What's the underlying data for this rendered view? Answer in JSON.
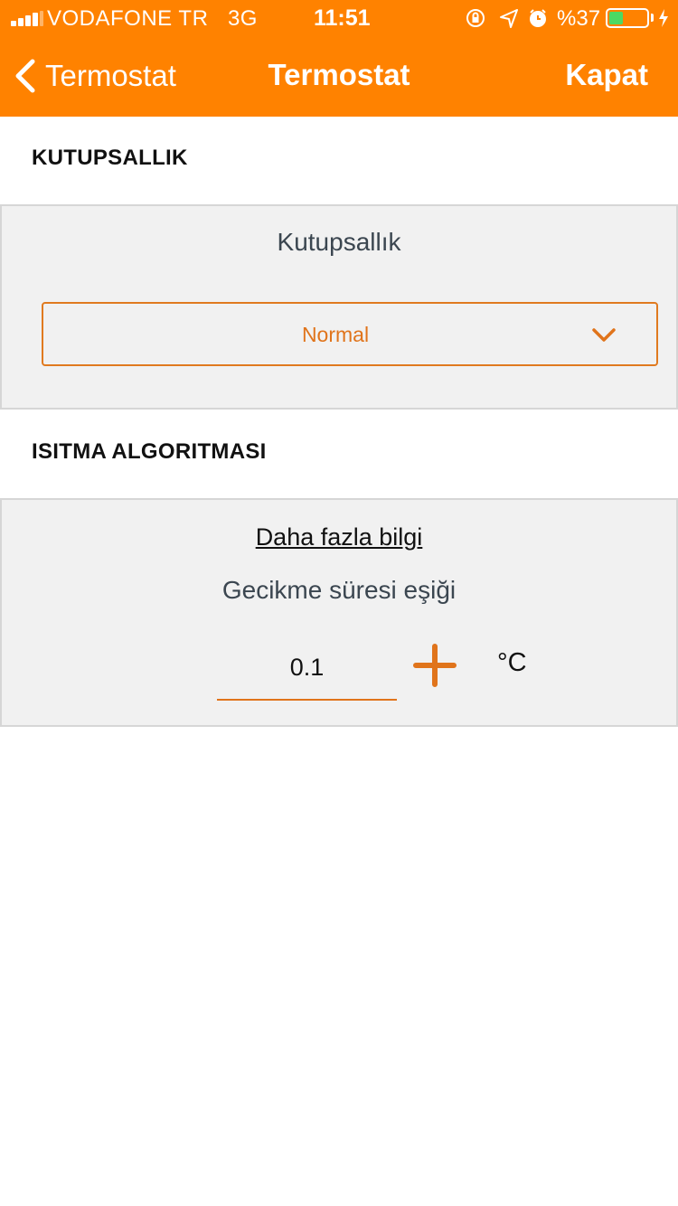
{
  "status_bar": {
    "carrier": "VODAFONE TR",
    "network": "3G",
    "time": "11:51",
    "battery_text": "%37",
    "battery_level": 0.37,
    "icons": [
      "signal-icon",
      "orientation-lock-icon",
      "location-icon",
      "alarm-icon",
      "battery-icon",
      "charging-icon"
    ]
  },
  "nav": {
    "back_label": "Termostat",
    "title": "Termostat",
    "close_label": "Kapat"
  },
  "polarity": {
    "section_header": "KUTUPSALLIK",
    "panel_title": "Kutupsallık",
    "selected_value": "Normal"
  },
  "heating": {
    "section_header": "ISITMA ALGORITMASI",
    "more_info_link": "Daha fazla bilgi",
    "field_label": "Gecikme süresi eşiği",
    "value": "0.1",
    "unit": "°C"
  },
  "colors": {
    "brand_orange": "#ff8200",
    "accent_orange": "#e0741b",
    "panel_bg": "#f1f1f1",
    "battery_green": "#4cd964"
  }
}
